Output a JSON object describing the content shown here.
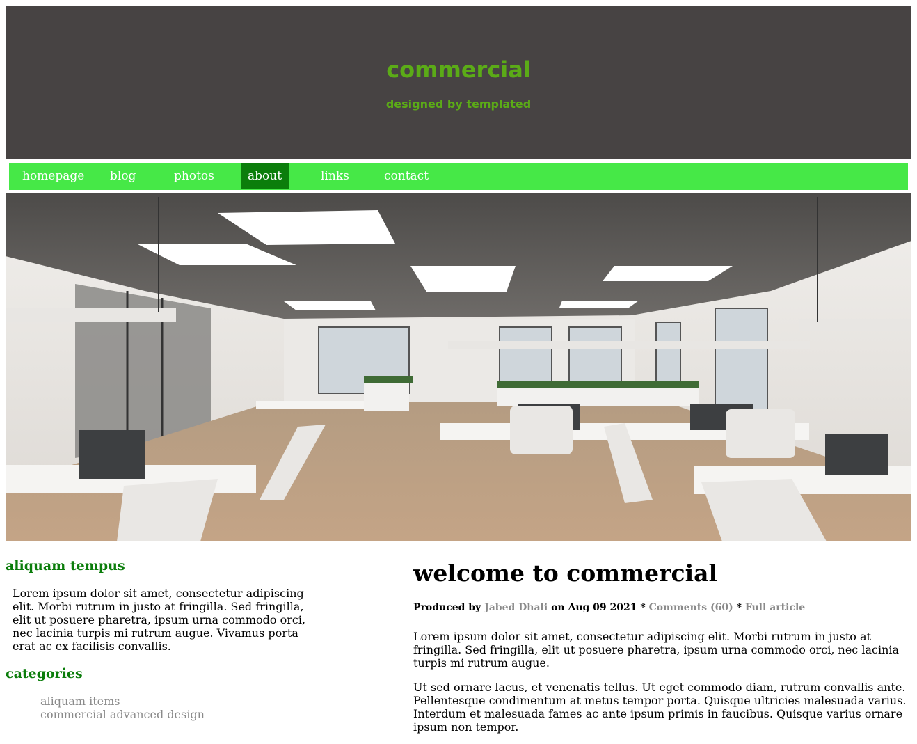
{
  "header": {
    "title": "commercial",
    "subtitle": "designed by templated"
  },
  "nav": {
    "items": [
      {
        "label": "homepage"
      },
      {
        "label": "blog"
      },
      {
        "label": "photos"
      },
      {
        "label": "about"
      },
      {
        "label": "links"
      },
      {
        "label": "contact"
      }
    ],
    "active": "about"
  },
  "colors": {
    "header_bg": "#474343",
    "title": "#5bab17",
    "nav_bg": "#46e847",
    "nav_active": "#0b7d0b",
    "heading_green": "#0b7d0b",
    "link_gray": "#8a8a8a"
  },
  "hero": {
    "image": "office-interior-photo"
  },
  "sidebar": {
    "heading1": "aliquam tempus",
    "text": "Lorem ipsum dolor sit amet, consectetur adipiscing elit. Morbi rutrum in justo at fringilla. Sed fringilla, elit ut posuere pharetra, ipsum urna commodo orci, nec lacinia turpis mi rutrum augue. Vivamus porta erat ac ex facilisis convallis.",
    "heading2": "categories",
    "categories": [
      "aliquam items",
      "commercial advanced design"
    ]
  },
  "main": {
    "title": "welcome to commercial",
    "meta": {
      "produced_by": "Produced by",
      "author": "Jabed Dhali",
      "date": "on Aug 09 2021 *",
      "comments": "Comments (60)",
      "sep": "*",
      "full_article": "Full article"
    },
    "paragraph1": "Lorem ipsum dolor sit amet, consectetur adipiscing elit. Morbi rutrum in justo at fringilla. Sed fringilla, elit ut posuere pharetra, ipsum urna commodo orci, nec lacinia turpis mi rutrum augue.",
    "paragraph2": "Ut sed ornare lacus, et venenatis tellus. Ut eget commodo diam, rutrum convallis ante. Pellentesque condimentum at metus tempor porta. Quisque ultricies malesuada varius. Interdum et malesuada fames ac ante ipsum primis in faucibus. Quisque varius ornare ipsum non tempor."
  }
}
